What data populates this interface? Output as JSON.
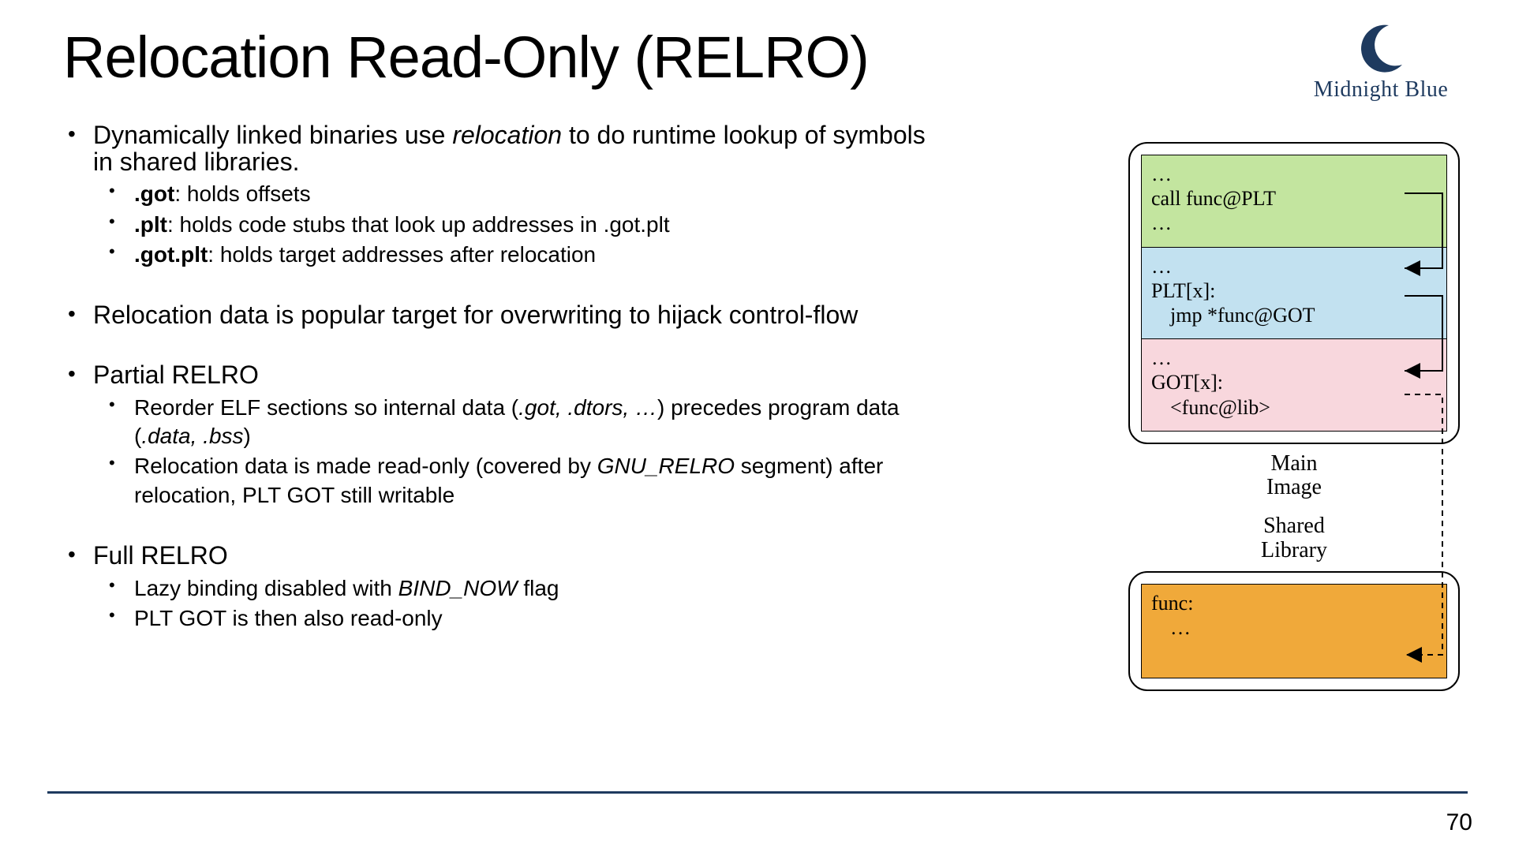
{
  "title": "Relocation Read-Only (RELRO)",
  "logo_text": "Midnight Blue",
  "page_number": "70",
  "bullets": {
    "b1_pre": "Dynamically linked binaries use ",
    "b1_em": "relocation",
    "b1_post": " to do runtime lookup of symbols in shared libraries.",
    "b1_sub1_b": ".got",
    "b1_sub1_rest": ": holds offsets",
    "b1_sub2_b": ".plt",
    "b1_sub2_rest": ": holds code stubs that look up addresses in .got.plt",
    "b1_sub3_b": ".got.plt",
    "b1_sub3_rest": ": holds target addresses after relocation",
    "b2": "Relocation data is popular target for overwriting to hijack control-flow",
    "b3": "Partial RELRO",
    "b3_sub1_pre": "Reorder ELF sections so internal data (",
    "b3_sub1_em1": ".got, .dtors, …",
    "b3_sub1_mid": ") precedes program data (",
    "b3_sub1_em2": ".data, .bss",
    "b3_sub1_post": ")",
    "b3_sub2_pre": "Relocation data is made read-only (covered by ",
    "b3_sub2_em": "GNU_RELRO",
    "b3_sub2_post": " segment) after relocation, PLT GOT still writable",
    "b4": "Full RELRO",
    "b4_sub1_pre": "Lazy binding disabled with ",
    "b4_sub1_em": "BIND_NOW",
    "b4_sub1_post": " flag",
    "b4_sub2": "PLT GOT is then also read-only"
  },
  "diagram": {
    "green_l1": "…",
    "green_l2": "call func@PLT",
    "green_l3": "…",
    "blue_l1": "…",
    "blue_l2": "PLT[x]:",
    "blue_l3": "jmp *func@GOT",
    "pink_l1": "…",
    "pink_l2": "GOT[x]:",
    "pink_l3": "<func@lib>",
    "label_main_l1": "Main",
    "label_main_l2": "Image",
    "label_shared_l1": "Shared",
    "label_shared_l2": "Library",
    "orange_l1": "func:",
    "orange_l2": "…"
  }
}
